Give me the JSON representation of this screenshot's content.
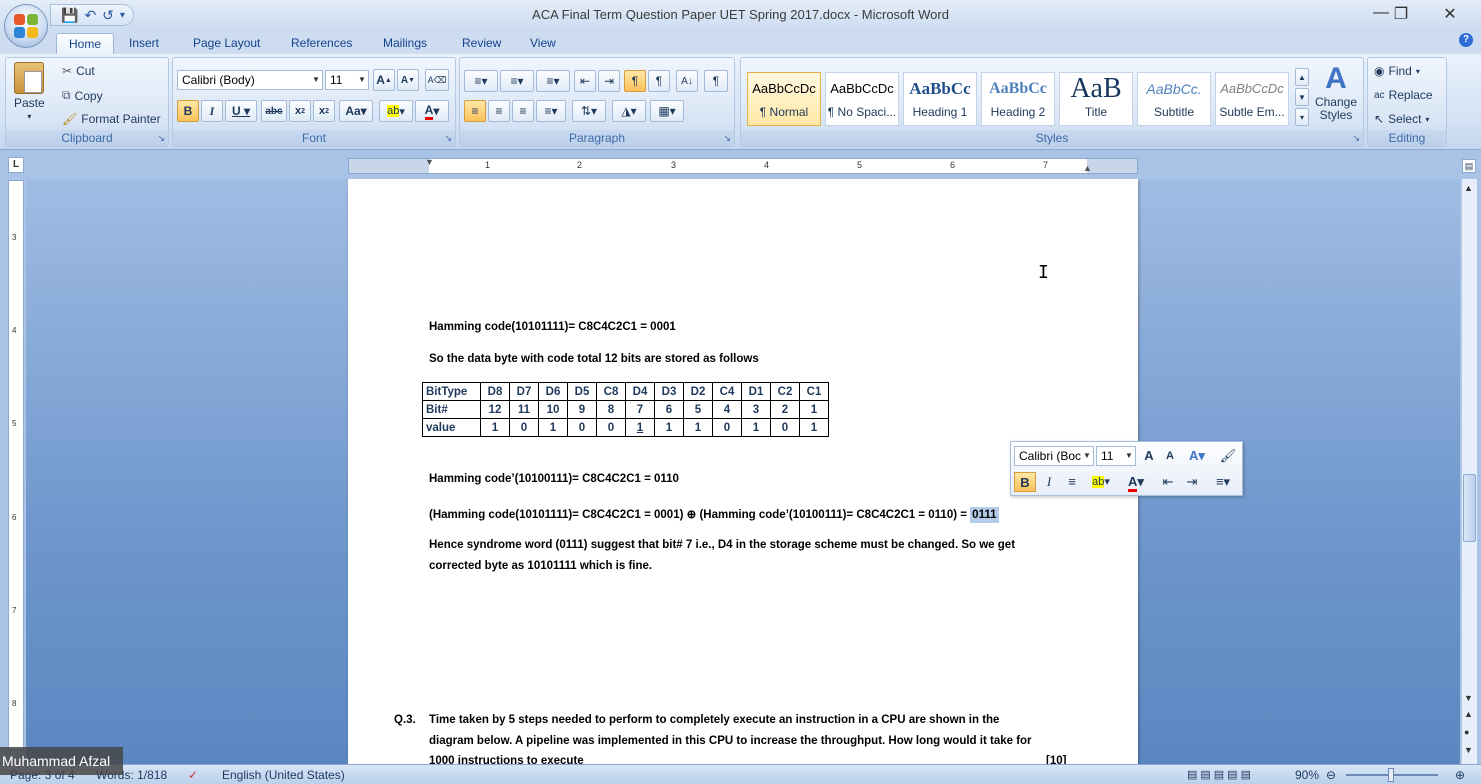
{
  "window": {
    "title": "ACA Final Term Question Paper UET Spring 2017.docx - Microsoft Word"
  },
  "tabs": [
    "Home",
    "Insert",
    "Page Layout",
    "References",
    "Mailings",
    "Review",
    "View"
  ],
  "clipboard": {
    "paste": "Paste",
    "cut": "Cut",
    "copy": "Copy",
    "format_painter": "Format Painter",
    "label": "Clipboard"
  },
  "font": {
    "name": "Calibri (Body)",
    "size": "11",
    "label": "Font"
  },
  "paragraph": {
    "label": "Paragraph"
  },
  "styles": {
    "label": "Styles",
    "items": [
      {
        "sample": "AaBbCcDc",
        "name": "¶ Normal"
      },
      {
        "sample": "AaBbCcDc",
        "name": "¶ No Spaci..."
      },
      {
        "sample": "AaBbCc",
        "name": "Heading 1"
      },
      {
        "sample": "AaBbCc",
        "name": "Heading 2"
      },
      {
        "sample": "AaB",
        "name": "Title"
      },
      {
        "sample": "AaBbCc.",
        "name": "Subtitle"
      },
      {
        "sample": "AaBbCcDc",
        "name": "Subtle Em..."
      }
    ],
    "change_styles": "Change Styles"
  },
  "editing": {
    "find": "Find",
    "replace": "Replace",
    "select": "Select",
    "label": "Editing"
  },
  "doc": {
    "line1": "Hamming code(10101111)= C8C4C2C1 = 0001",
    "line2": "So the data  byte with code total 12 bits are stored as follows",
    "table": {
      "header": [
        "BitType",
        "D8",
        "D7",
        "D6",
        "D5",
        "C8",
        "D4",
        "D3",
        "D2",
        "C4",
        "D1",
        "C2",
        "C1"
      ],
      "bitnum": [
        "Bit#",
        "12",
        "11",
        "10",
        "9",
        "8",
        "7",
        "6",
        "5",
        "4",
        "3",
        "2",
        "1"
      ],
      "value": [
        "value",
        "1",
        "0",
        "1",
        "0",
        "0",
        "1",
        "1",
        "1",
        "0",
        "1",
        "0",
        "1"
      ]
    },
    "line3": "Hamming code’(10100111)= C8C4C2C1 = 0110",
    "line4_pre": "(Hamming code(10101111)= C8C4C2C1 = 0001) ⊕  (Hamming code’(10100111)= C8C4C2C1 = 0110) = ",
    "line4_sel": "0111",
    "line5a": "Hence syndrome word (0111) suggest that bit# 7 i.e., D4 in the storage scheme must be changed.  So we get",
    "line5b": "corrected byte as 10101111 which is fine.",
    "q3_num": "Q.3.",
    "q3_a": "Time taken by 5 steps needed to perform to completely execute an instruction in a CPU are shown in the",
    "q3_b": "diagram below. A pipeline was implemented in this CPU to increase the throughput. How long would it take for",
    "q3_c": "1000  instructions to execute",
    "q3_marks": "[10]"
  },
  "mini_toolbar": {
    "font": "Calibri (Boc",
    "size": "11"
  },
  "status": {
    "page": "Page: 3 of 4",
    "words": "Words: 1/818",
    "language": "English (United States)",
    "zoom": "90%"
  },
  "overlay": {
    "name": "Muhammad Afzal"
  },
  "ruler": {
    "h": [
      "1",
      "2",
      "3",
      "4",
      "5",
      "6",
      "7"
    ],
    "v": [
      "3",
      "4",
      "5",
      "6",
      "7",
      "8"
    ]
  }
}
